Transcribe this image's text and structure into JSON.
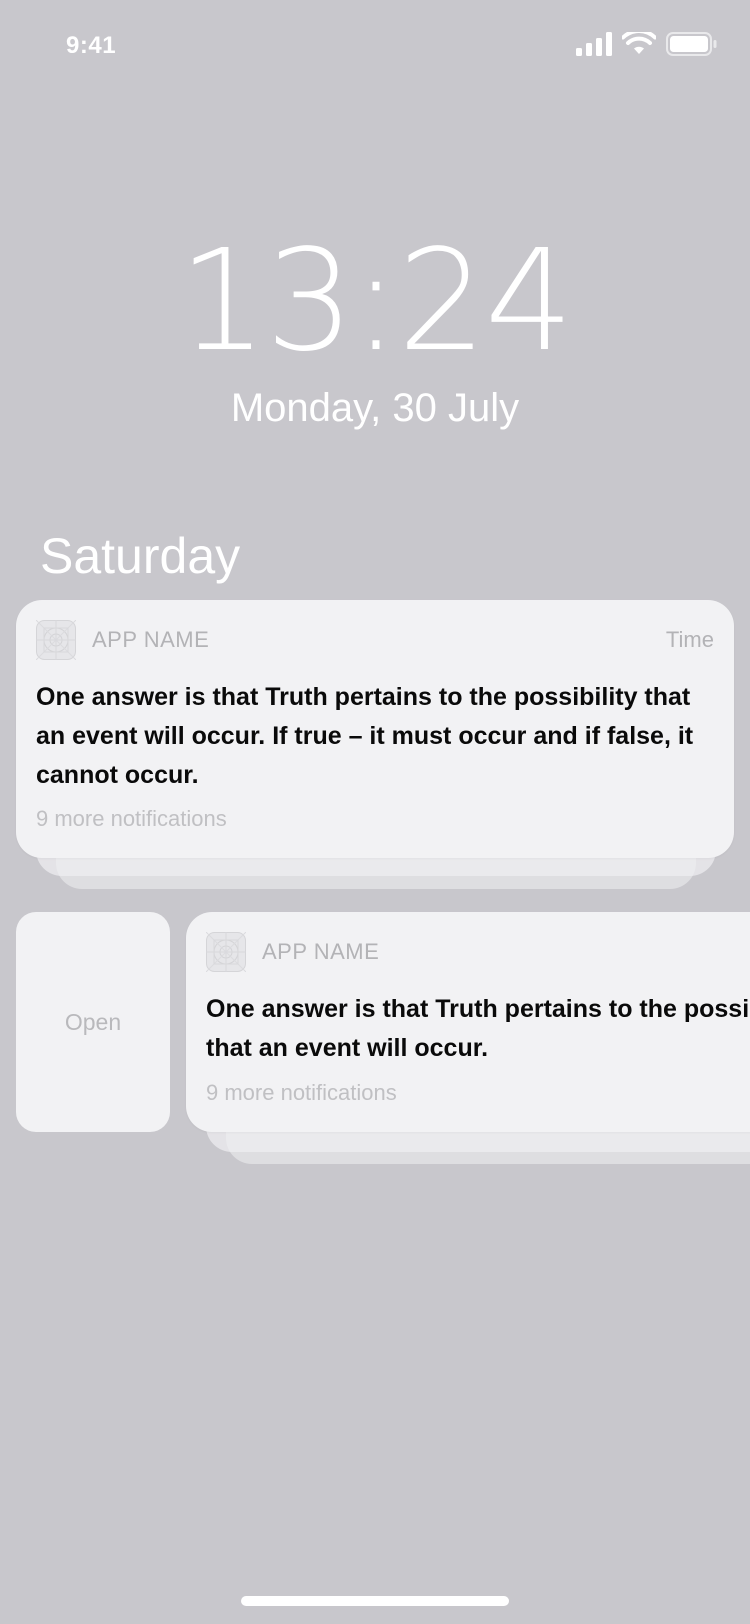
{
  "status_bar": {
    "time": "9:41",
    "icons": [
      "cellular-signal-icon",
      "wifi-icon",
      "battery-icon"
    ]
  },
  "lock_screen": {
    "clock": "13:24",
    "date": "Monday, 30 July",
    "section_title": "Saturday"
  },
  "notifications": [
    {
      "app_name": "APP NAME",
      "time": "Time",
      "message": "One answer is that Truth pertains to the possibility that an event will occur. If true – it must occur and if false, it cannot occur.",
      "more": "9 more notifications"
    },
    {
      "app_name": "APP NAME",
      "message": "One answer is that Truth pertains to the possibility that an event will occur.",
      "more": "9 more notifications"
    }
  ],
  "swipe_action": {
    "open_label": "Open"
  },
  "colors": {
    "background": "#c8c7cc",
    "card": "#f2f2f4",
    "muted_text": "#b3b3b6",
    "primary_text": "#0a0a0a"
  }
}
